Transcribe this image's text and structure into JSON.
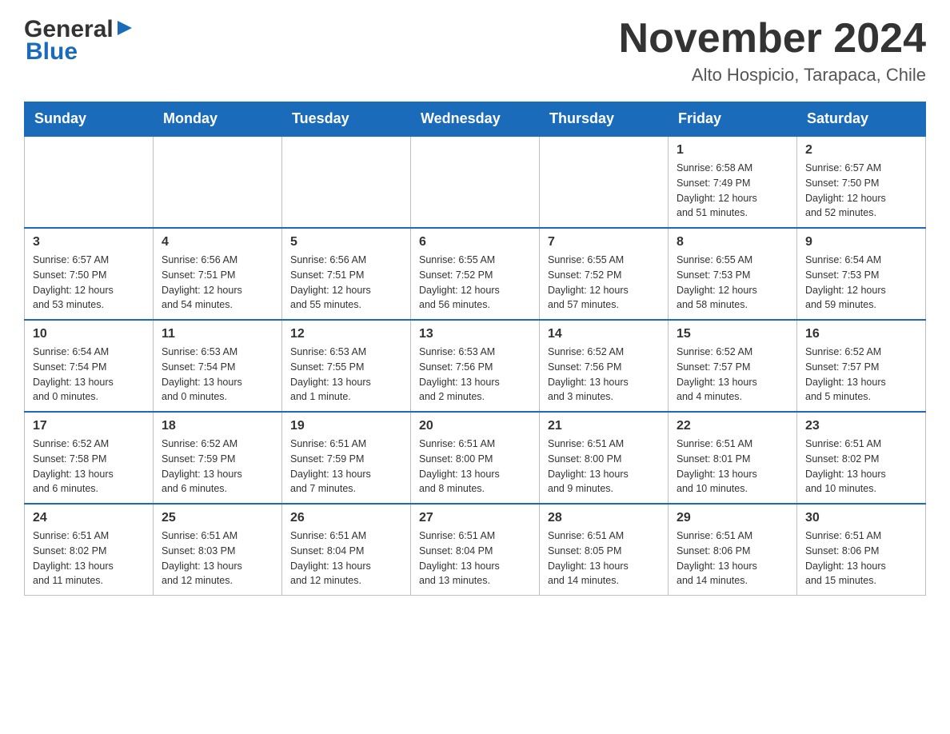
{
  "header": {
    "logo_general": "General",
    "logo_blue": "Blue",
    "month_year": "November 2024",
    "location": "Alto Hospicio, Tarapaca, Chile"
  },
  "days_of_week": [
    "Sunday",
    "Monday",
    "Tuesday",
    "Wednesday",
    "Thursday",
    "Friday",
    "Saturday"
  ],
  "weeks": [
    [
      {
        "day": "",
        "info": ""
      },
      {
        "day": "",
        "info": ""
      },
      {
        "day": "",
        "info": ""
      },
      {
        "day": "",
        "info": ""
      },
      {
        "day": "",
        "info": ""
      },
      {
        "day": "1",
        "info": "Sunrise: 6:58 AM\nSunset: 7:49 PM\nDaylight: 12 hours\nand 51 minutes."
      },
      {
        "day": "2",
        "info": "Sunrise: 6:57 AM\nSunset: 7:50 PM\nDaylight: 12 hours\nand 52 minutes."
      }
    ],
    [
      {
        "day": "3",
        "info": "Sunrise: 6:57 AM\nSunset: 7:50 PM\nDaylight: 12 hours\nand 53 minutes."
      },
      {
        "day": "4",
        "info": "Sunrise: 6:56 AM\nSunset: 7:51 PM\nDaylight: 12 hours\nand 54 minutes."
      },
      {
        "day": "5",
        "info": "Sunrise: 6:56 AM\nSunset: 7:51 PM\nDaylight: 12 hours\nand 55 minutes."
      },
      {
        "day": "6",
        "info": "Sunrise: 6:55 AM\nSunset: 7:52 PM\nDaylight: 12 hours\nand 56 minutes."
      },
      {
        "day": "7",
        "info": "Sunrise: 6:55 AM\nSunset: 7:52 PM\nDaylight: 12 hours\nand 57 minutes."
      },
      {
        "day": "8",
        "info": "Sunrise: 6:55 AM\nSunset: 7:53 PM\nDaylight: 12 hours\nand 58 minutes."
      },
      {
        "day": "9",
        "info": "Sunrise: 6:54 AM\nSunset: 7:53 PM\nDaylight: 12 hours\nand 59 minutes."
      }
    ],
    [
      {
        "day": "10",
        "info": "Sunrise: 6:54 AM\nSunset: 7:54 PM\nDaylight: 13 hours\nand 0 minutes."
      },
      {
        "day": "11",
        "info": "Sunrise: 6:53 AM\nSunset: 7:54 PM\nDaylight: 13 hours\nand 0 minutes."
      },
      {
        "day": "12",
        "info": "Sunrise: 6:53 AM\nSunset: 7:55 PM\nDaylight: 13 hours\nand 1 minute."
      },
      {
        "day": "13",
        "info": "Sunrise: 6:53 AM\nSunset: 7:56 PM\nDaylight: 13 hours\nand 2 minutes."
      },
      {
        "day": "14",
        "info": "Sunrise: 6:52 AM\nSunset: 7:56 PM\nDaylight: 13 hours\nand 3 minutes."
      },
      {
        "day": "15",
        "info": "Sunrise: 6:52 AM\nSunset: 7:57 PM\nDaylight: 13 hours\nand 4 minutes."
      },
      {
        "day": "16",
        "info": "Sunrise: 6:52 AM\nSunset: 7:57 PM\nDaylight: 13 hours\nand 5 minutes."
      }
    ],
    [
      {
        "day": "17",
        "info": "Sunrise: 6:52 AM\nSunset: 7:58 PM\nDaylight: 13 hours\nand 6 minutes."
      },
      {
        "day": "18",
        "info": "Sunrise: 6:52 AM\nSunset: 7:59 PM\nDaylight: 13 hours\nand 6 minutes."
      },
      {
        "day": "19",
        "info": "Sunrise: 6:51 AM\nSunset: 7:59 PM\nDaylight: 13 hours\nand 7 minutes."
      },
      {
        "day": "20",
        "info": "Sunrise: 6:51 AM\nSunset: 8:00 PM\nDaylight: 13 hours\nand 8 minutes."
      },
      {
        "day": "21",
        "info": "Sunrise: 6:51 AM\nSunset: 8:00 PM\nDaylight: 13 hours\nand 9 minutes."
      },
      {
        "day": "22",
        "info": "Sunrise: 6:51 AM\nSunset: 8:01 PM\nDaylight: 13 hours\nand 10 minutes."
      },
      {
        "day": "23",
        "info": "Sunrise: 6:51 AM\nSunset: 8:02 PM\nDaylight: 13 hours\nand 10 minutes."
      }
    ],
    [
      {
        "day": "24",
        "info": "Sunrise: 6:51 AM\nSunset: 8:02 PM\nDaylight: 13 hours\nand 11 minutes."
      },
      {
        "day": "25",
        "info": "Sunrise: 6:51 AM\nSunset: 8:03 PM\nDaylight: 13 hours\nand 12 minutes."
      },
      {
        "day": "26",
        "info": "Sunrise: 6:51 AM\nSunset: 8:04 PM\nDaylight: 13 hours\nand 12 minutes."
      },
      {
        "day": "27",
        "info": "Sunrise: 6:51 AM\nSunset: 8:04 PM\nDaylight: 13 hours\nand 13 minutes."
      },
      {
        "day": "28",
        "info": "Sunrise: 6:51 AM\nSunset: 8:05 PM\nDaylight: 13 hours\nand 14 minutes."
      },
      {
        "day": "29",
        "info": "Sunrise: 6:51 AM\nSunset: 8:06 PM\nDaylight: 13 hours\nand 14 minutes."
      },
      {
        "day": "30",
        "info": "Sunrise: 6:51 AM\nSunset: 8:06 PM\nDaylight: 13 hours\nand 15 minutes."
      }
    ]
  ]
}
